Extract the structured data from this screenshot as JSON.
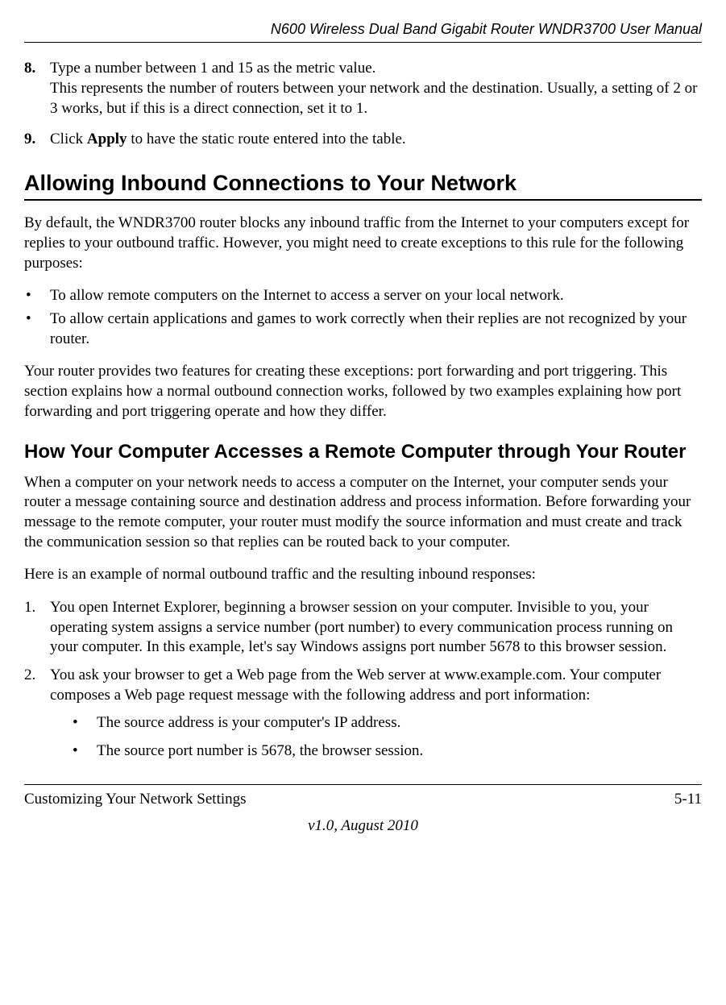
{
  "header": {
    "doc_title": "N600 Wireless Dual Band Gigabit Router WNDR3700 User Manual"
  },
  "steps": {
    "s8": {
      "num": "8.",
      "line1": "Type a number between 1 and 15 as the metric value.",
      "line2": "This represents the number of routers between your network and the destination. Usually, a setting of 2 or 3 works, but if this is a direct connection, set it to 1."
    },
    "s9": {
      "num": "9.",
      "pre": "Click ",
      "bold": "Apply",
      "post": " to have the static route entered into the table."
    }
  },
  "section_title": "Allowing Inbound Connections to Your Network",
  "intro_para": "By default, the WNDR3700 router blocks any inbound traffic from the Internet to your computers except for replies to your outbound traffic. However, you might need to create exceptions to this rule for the following purposes:",
  "intro_bullets": [
    "To allow remote computers on the Internet to access a server on your local network.",
    "To allow certain applications and games to work correctly when their replies are not recognized by your router."
  ],
  "intro_para2": "Your router provides two features for creating these exceptions: port forwarding and port triggering. This section explains how a normal outbound connection works, followed by two examples explaining how port forwarding and port triggering operate and how they differ.",
  "subsection_title": "How Your Computer Accesses a Remote Computer through Your Router",
  "sub_para1": "When a computer on your network needs to access a computer on the Internet, your computer sends your router a message containing source and destination address and process information. Before forwarding your message to the remote computer, your router must modify the source information and must create and track the communication session so that replies can be routed back to your computer.",
  "sub_para2": "Here is an example of normal outbound traffic and the resulting inbound responses:",
  "numlist": {
    "i1": {
      "num": "1.",
      "text": "You open Internet Explorer, beginning a browser session on your computer. Invisible to you, your operating system assigns a service number (port number) to every communication process running on your computer. In this example, let's say Windows assigns port number 5678 to this browser session."
    },
    "i2": {
      "num": "2.",
      "text": "You ask your browser to get a Web page from the Web server at www.example.com. Your computer composes a Web page request message with the following address and port information:",
      "sub": [
        "The source address is your computer's IP address.",
        "The source port number is 5678, the browser session."
      ]
    }
  },
  "footer": {
    "left": "Customizing Your Network Settings",
    "right": "5-11",
    "center": "v1.0, August 2010"
  },
  "glyphs": {
    "bullet": "•"
  }
}
